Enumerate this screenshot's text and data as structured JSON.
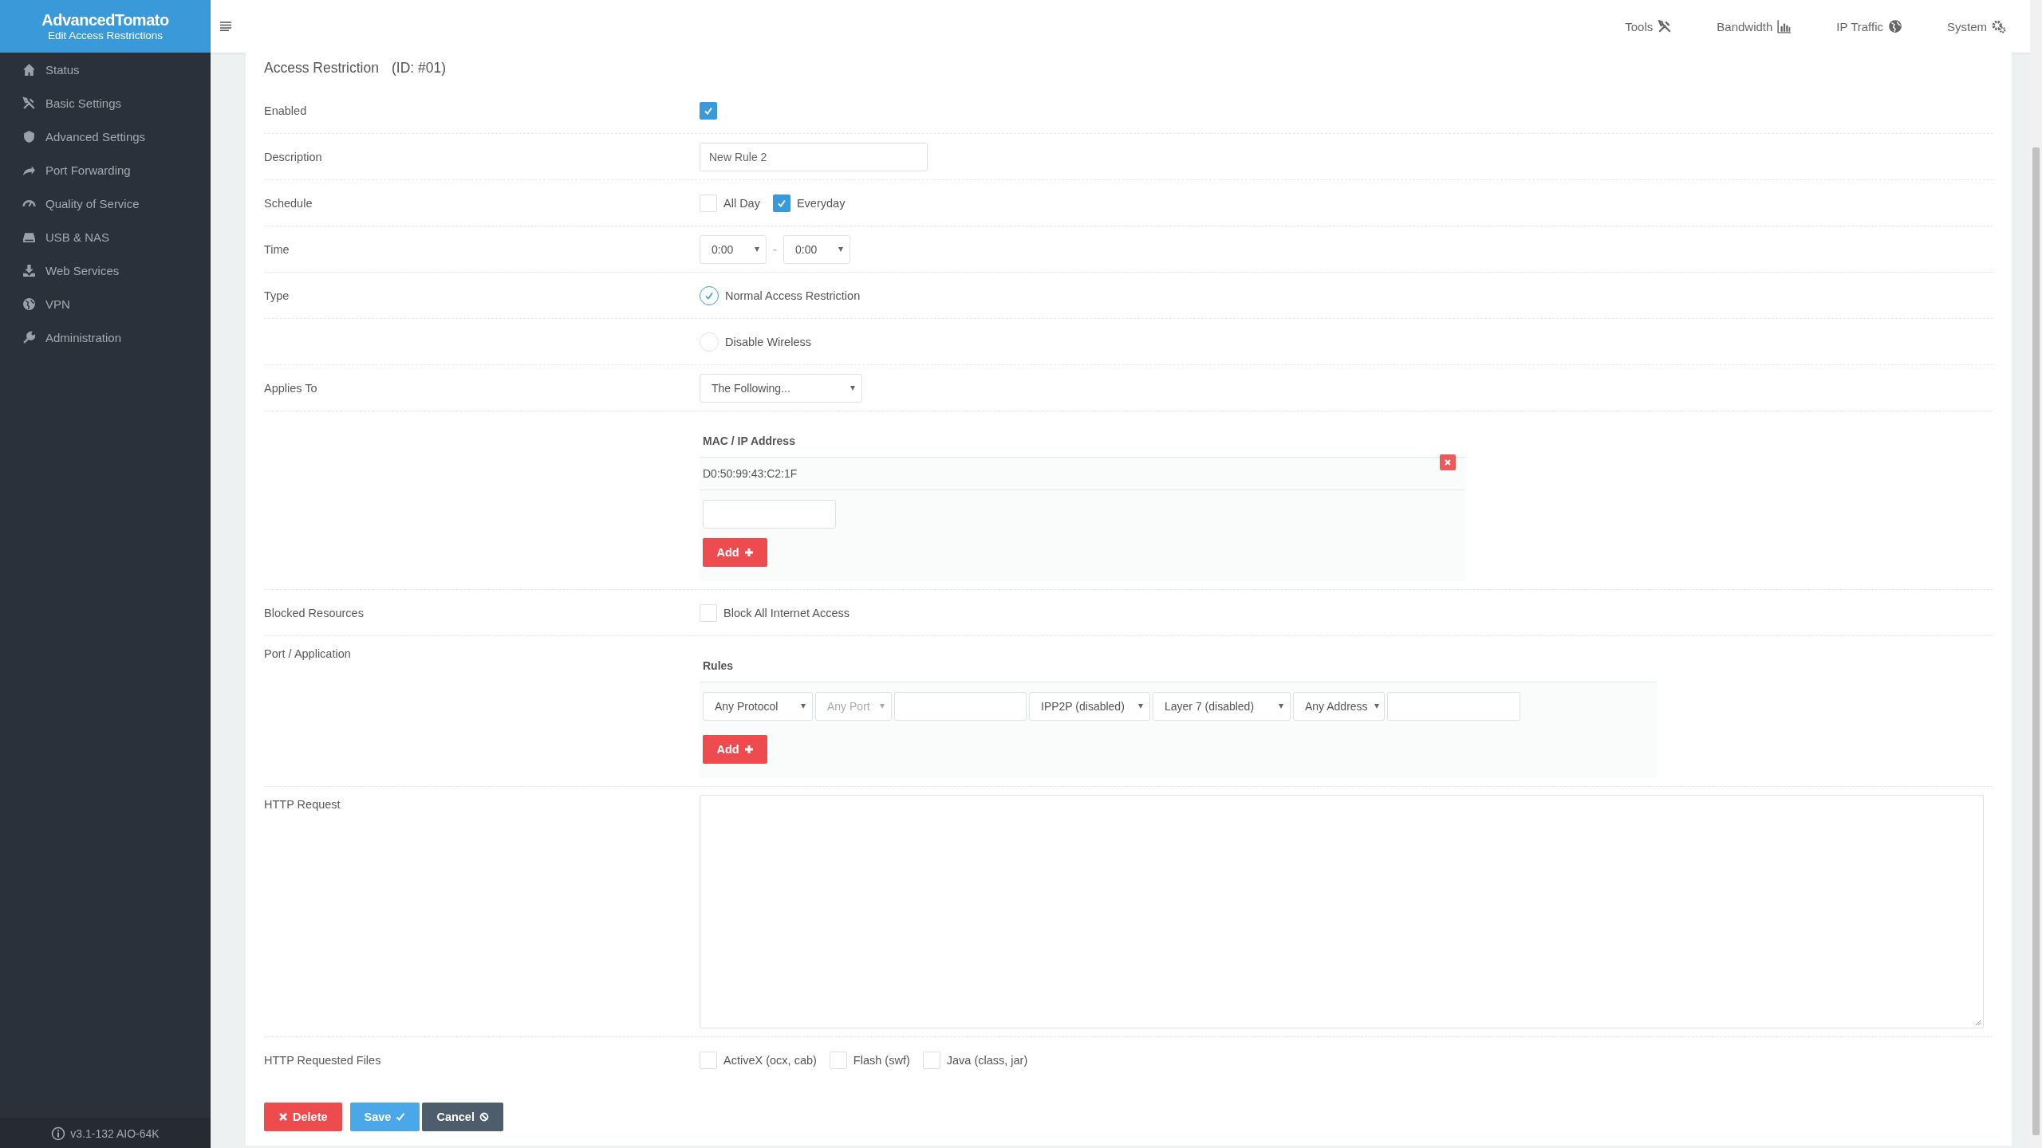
{
  "brand": {
    "title": "AdvancedTomato",
    "subtitle": "Edit Access Restrictions"
  },
  "sidebar": {
    "items": [
      {
        "label": "Status"
      },
      {
        "label": "Basic Settings"
      },
      {
        "label": "Advanced Settings"
      },
      {
        "label": "Port Forwarding"
      },
      {
        "label": "Quality of Service"
      },
      {
        "label": "USB & NAS"
      },
      {
        "label": "Web Services"
      },
      {
        "label": "VPN"
      },
      {
        "label": "Administration"
      }
    ],
    "version": "v3.1-132 AIO-64K"
  },
  "top_nav": [
    {
      "label": "Tools"
    },
    {
      "label": "Bandwidth"
    },
    {
      "label": "IP Traffic"
    },
    {
      "label": "System"
    }
  ],
  "form": {
    "title": "Access Restriction",
    "id_label": "(ID: #01)",
    "enabled": {
      "label": "Enabled",
      "checked": true
    },
    "description": {
      "label": "Description",
      "value": "New Rule 2"
    },
    "schedule": {
      "label": "Schedule",
      "options": [
        {
          "label": "All Day",
          "checked": false
        },
        {
          "label": "Everyday",
          "checked": true
        }
      ]
    },
    "time": {
      "label": "Time",
      "from": "0:00",
      "separator": "-",
      "to": "0:00"
    },
    "type": {
      "label": "Type",
      "options": [
        {
          "label": "Normal Access Restriction",
          "selected": true
        },
        {
          "label": "Disable Wireless",
          "selected": false
        }
      ]
    },
    "applies_to": {
      "label": "Applies To",
      "value": "The Following..."
    },
    "mac_list": {
      "header": "MAC / IP Address",
      "entries": [
        "D0:50:99:43:C2:1F"
      ],
      "add_button": "Add"
    },
    "blocked": {
      "label": "Blocked Resources",
      "option": {
        "label": "Block All Internet Access",
        "checked": false
      }
    },
    "port_app": {
      "label": "Port / Application",
      "header": "Rules",
      "protocol": {
        "value": "Any Protocol",
        "disabled": false
      },
      "port": {
        "value": "Any Port",
        "disabled": true
      },
      "ipp2p": {
        "value": "IPP2P (disabled)",
        "disabled": false
      },
      "layer7": {
        "value": "Layer 7 (disabled)",
        "disabled": false
      },
      "address": {
        "value": "Any Address",
        "disabled": false
      },
      "add_button": "Add"
    },
    "http_request": {
      "label": "HTTP Request"
    },
    "http_files": {
      "label": "HTTP Requested Files",
      "options": [
        {
          "label": "ActiveX (ocx, cab)",
          "checked": false
        },
        {
          "label": "Flash (swf)",
          "checked": false
        },
        {
          "label": "Java (class, jar)",
          "checked": false
        }
      ]
    },
    "buttons": [
      {
        "label": "Delete",
        "kind": "delete"
      },
      {
        "label": "Save",
        "kind": "save"
      },
      {
        "label": "Cancel",
        "kind": "cancel"
      }
    ]
  }
}
